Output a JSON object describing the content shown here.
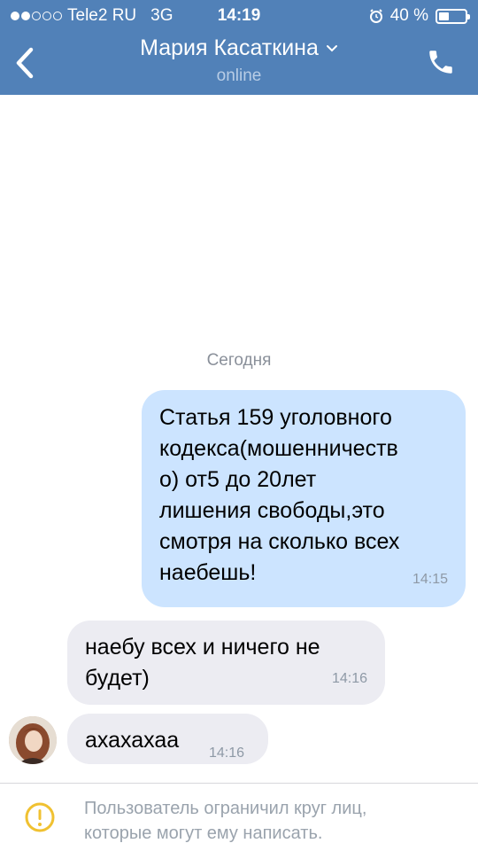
{
  "status_bar": {
    "carrier": "Tele2 RU",
    "network": "3G",
    "time": "14:19",
    "battery": "40 %",
    "battery_level": 0.4
  },
  "header": {
    "title": "Мария Касаткина",
    "subtitle": "online",
    "back_icon": "chevron-left-icon",
    "call_icon": "phone-icon",
    "title_chevron_icon": "chevron-down-icon",
    "color": "#5181b8"
  },
  "chat": {
    "date_separator": "Сегодня",
    "messages": [
      {
        "direction": "outgoing",
        "text": "Статья 159 уголовного\nкодекса(мошенничеств\nо) от5 до 20лет\nлишения свободы,это\nсмотря на сколько всех\nнаебешь!",
        "time": "14:15",
        "color": "#cce4ff"
      },
      {
        "direction": "incoming",
        "text": "наебу всех и ничего не\nбудет)",
        "time": "14:16",
        "color": "#ececf2"
      },
      {
        "direction": "incoming",
        "text": "ахахахаа",
        "time": "14:16",
        "color": "#ececf2"
      }
    ]
  },
  "notice": {
    "icon": "warning-icon",
    "text": "Пользователь ограничил круг лиц,\nкоторые могут ему написать."
  }
}
